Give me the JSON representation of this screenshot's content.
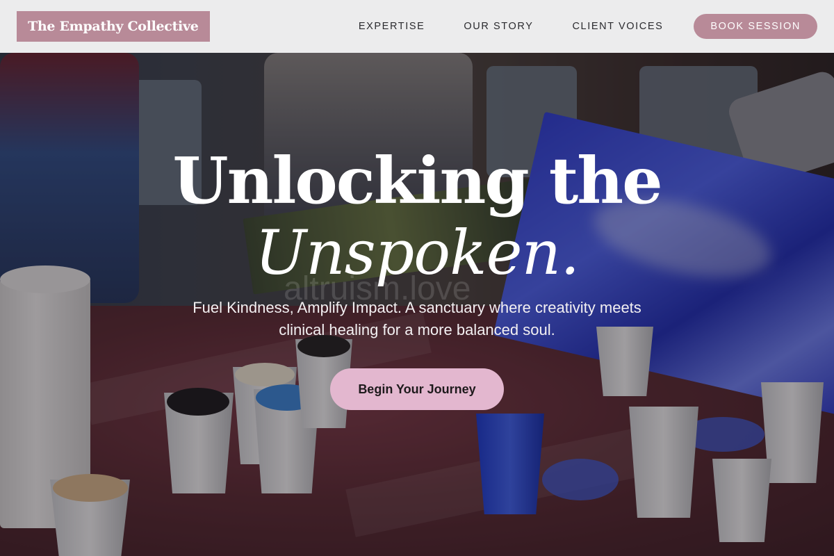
{
  "nav": {
    "logo": "The Empathy Collective",
    "links": [
      "EXPERTISE",
      "OUR STORY",
      "CLIENT VOICES"
    ],
    "cta": "BOOK SESSION"
  },
  "hero": {
    "headline_line1": "Unlocking the",
    "headline_line2": "Unspoken.",
    "watermark": "altruism.love",
    "subtitle": "Fuel Kindness, Amplify Impact. A sanctuary where creativity meets clinical healing for a more balanced soul.",
    "button": "Begin Your Journey",
    "image_description_icon": "art-workshop-photo"
  },
  "colors": {
    "brand": "#b88a98",
    "button": "#e3b7cf",
    "nav_bg": "#f5f5f6"
  }
}
